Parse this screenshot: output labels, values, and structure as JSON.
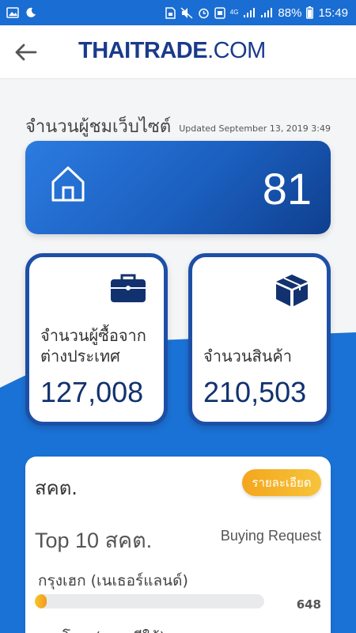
{
  "status_bar": {
    "network": "4G",
    "battery": "88%",
    "time": "15:49"
  },
  "header": {
    "logo_thai": "THAI",
    "logo_trade": "TRADE",
    "logo_com": ".COM"
  },
  "visitors": {
    "label": "จำนวนผู้ชมเว็บไซต์",
    "updated": "Updated September 13, 2019 3:49",
    "count": "81"
  },
  "stats": {
    "buyers": {
      "label": "จำนวนผู้ซื้อจากต่างประเทศ",
      "value": "127,008"
    },
    "products": {
      "label": "จำนวนสินค้า",
      "value": "210,503"
    }
  },
  "detail": {
    "title": "สคต.",
    "button_label": "รายละเอียด",
    "top_title": "Top 10 สคต.",
    "column_label": "Buying Request",
    "rows": [
      {
        "country": "กรุงเฮก (เนเธอร์แลนด์)",
        "value": "648",
        "fill_percent": 5
      },
      {
        "country": "กรุงโซล (เกาหลีใต้)"
      }
    ]
  },
  "colors": {
    "primary_blue": "#1a6dd2",
    "navy": "#12326f",
    "accent_orange": "#f4a61d"
  }
}
